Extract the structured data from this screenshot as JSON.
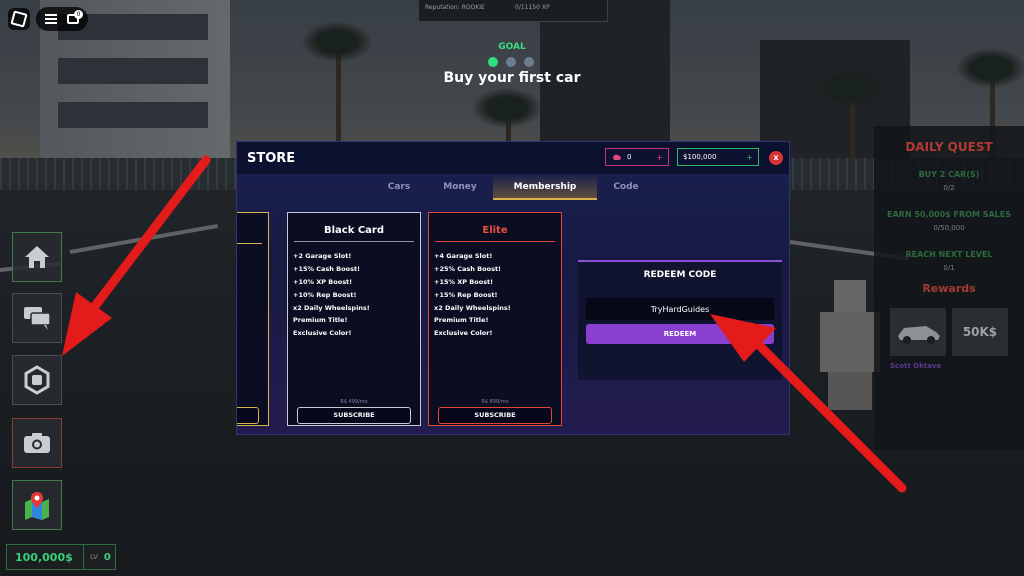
{
  "topbar": {
    "reputation_text": "Reputation: ROOKIE",
    "xp_text": "0/11150 XP",
    "chat_badge": "0"
  },
  "goal": {
    "label": "GOAL",
    "title": "Buy your first car",
    "steps": [
      "done",
      "pending",
      "pending"
    ]
  },
  "store": {
    "title": "STORE",
    "gems": "0",
    "cash": "$100,000",
    "close_label": "x",
    "tabs": [
      "Cars",
      "Money",
      "Membership",
      "Code"
    ],
    "active_tab": "Membership",
    "cards": [
      {
        "name": "Black Card",
        "border_color": "#c7c9d4",
        "title_color": "#ffffff",
        "perks": [
          "+2 Garage Slot!",
          "+15% Cash Boost!",
          "+10% XP Boost!",
          "+10% Rep Boost!",
          "x2 Daily Wheelspins!",
          "Premium Title!",
          "Exclusive Color!"
        ],
        "price": "R$ 499/mo",
        "button": "SUBSCRIBE"
      },
      {
        "name": "Elite",
        "border_color": "#e0473b",
        "title_color": "#e8503f",
        "perks": [
          "+4 Garage Slot!",
          "+25% Cash Boost!",
          "+15% XP Boost!",
          "+15% Rep Boost!",
          "x2 Daily Wheelspins!",
          "Premium Title!",
          "Exclusive Color!"
        ],
        "price": "R$ 899/mo",
        "button": "SUBSCRIBE"
      }
    ],
    "redeem": {
      "title": "REDEEM CODE",
      "value": "TryHardGuides",
      "button": "REDEEM"
    }
  },
  "sidebar": {
    "buttons": [
      {
        "name": "home-icon",
        "border": "#3f7a4a"
      },
      {
        "name": "chat-icon",
        "border": "#4a4f55"
      },
      {
        "name": "robux-icon",
        "border": "#4a4f55"
      },
      {
        "name": "camera-icon",
        "border": "#8a3b33"
      },
      {
        "name": "map-icon",
        "border": "#3f7a4a"
      }
    ]
  },
  "hud": {
    "money": "100,000$",
    "level_label": "LV",
    "level": "0"
  },
  "quest": {
    "title": "DAILY QUEST",
    "items": [
      {
        "text": "BUY 2 CAR(S)",
        "progress": "0/2"
      },
      {
        "text": "EARN 50,000$ FROM SALES",
        "progress": "0/50,000"
      },
      {
        "text": "REACH NEXT LEVEL",
        "progress": "0/1"
      }
    ],
    "rewards_label": "Rewards",
    "reward_cash": "50K$",
    "car_name": "Scott Oktave"
  },
  "colors": {
    "accent_green": "#37d37a",
    "accent_purple": "#8a3fd0",
    "elite_red": "#e0473b",
    "tab_gold": "#d9b24a"
  }
}
